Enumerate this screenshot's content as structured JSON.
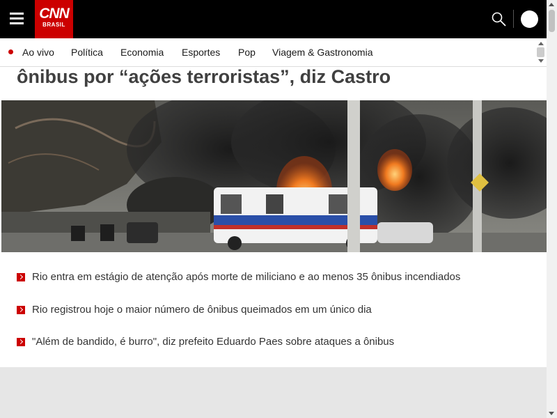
{
  "header": {
    "logo_top": "CNN",
    "logo_bottom": "BRASIL",
    "menu_icon": "hamburger-menu-icon",
    "search_icon": "search-icon",
    "avatar_icon": "user-avatar-icon"
  },
  "nav": {
    "items": [
      {
        "label": "Ao vivo",
        "live": true
      },
      {
        "label": "Política"
      },
      {
        "label": "Economia"
      },
      {
        "label": "Esportes"
      },
      {
        "label": "Pop"
      },
      {
        "label": "Viagem & Gastronomia"
      }
    ]
  },
  "article": {
    "headline_visible": "ônibus por “ações terroristas”, diz Castro",
    "related": [
      "Rio entra em estágio de atenção após morte de miliciano e ao menos 35 ônibus incendiados",
      "Rio registrou hoje o maior número de ônibus queimados em um único dia",
      "\"Além de bandido, é burro\", diz prefeito Eduardo Paes sobre ataques a ônibus"
    ]
  },
  "colors": {
    "brand_red": "#cc0000",
    "header_bg": "#000000",
    "headline_text": "#404040"
  }
}
